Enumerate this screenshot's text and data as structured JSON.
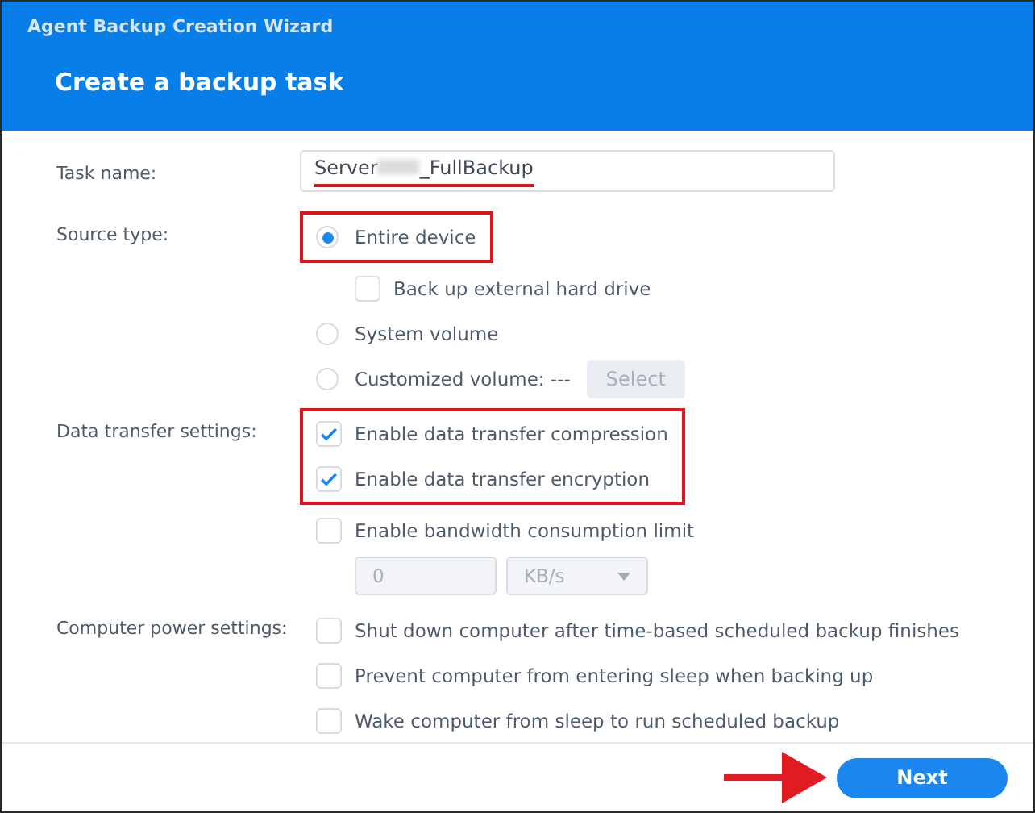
{
  "window": {
    "title": "Agent Backup Creation Wizard"
  },
  "heading": "Create a backup task",
  "fields": [
    {
      "kind": "text",
      "label": "Task name:",
      "value_start": "Server",
      "value_end": "_FullBackup",
      "redacted": true,
      "underlined": true
    },
    {
      "kind": "options",
      "label": "Source type:",
      "options": [
        {
          "kind": "radio",
          "label": "Entire device",
          "selected": true,
          "highlighted": true,
          "children": [
            {
              "kind": "checkbox",
              "label": "Back up external hard drive",
              "checked": false
            }
          ]
        },
        {
          "kind": "radio",
          "label": "System volume",
          "selected": false
        },
        {
          "kind": "radio",
          "label": "Customized volume: ---",
          "selected": false,
          "button": {
            "label": "Select",
            "disabled": true
          }
        }
      ]
    },
    {
      "kind": "options",
      "label": "Data transfer settings:",
      "options": [
        {
          "kind": "checkbox",
          "label": "Enable data transfer compression",
          "checked": true,
          "highlighted": true
        },
        {
          "kind": "checkbox",
          "label": "Enable data transfer encryption",
          "checked": true,
          "highlighted": true
        },
        {
          "kind": "checkbox",
          "label": "Enable bandwidth consumption limit",
          "checked": false,
          "children": [
            {
              "kind": "unit-inputs",
              "value": "0",
              "unit": "KB/s",
              "disabled": true
            }
          ]
        }
      ]
    },
    {
      "kind": "options",
      "label": "Computer power settings:",
      "options": [
        {
          "kind": "checkbox",
          "label": "Shut down computer after time-based scheduled backup finishes",
          "checked": false
        },
        {
          "kind": "checkbox",
          "label": "Prevent computer from entering sleep when backing up",
          "checked": false
        },
        {
          "kind": "checkbox",
          "label": "Wake computer from sleep to run scheduled backup",
          "checked": false
        }
      ]
    }
  ],
  "footer": {
    "button": "Next",
    "pointer_arrow": true
  }
}
